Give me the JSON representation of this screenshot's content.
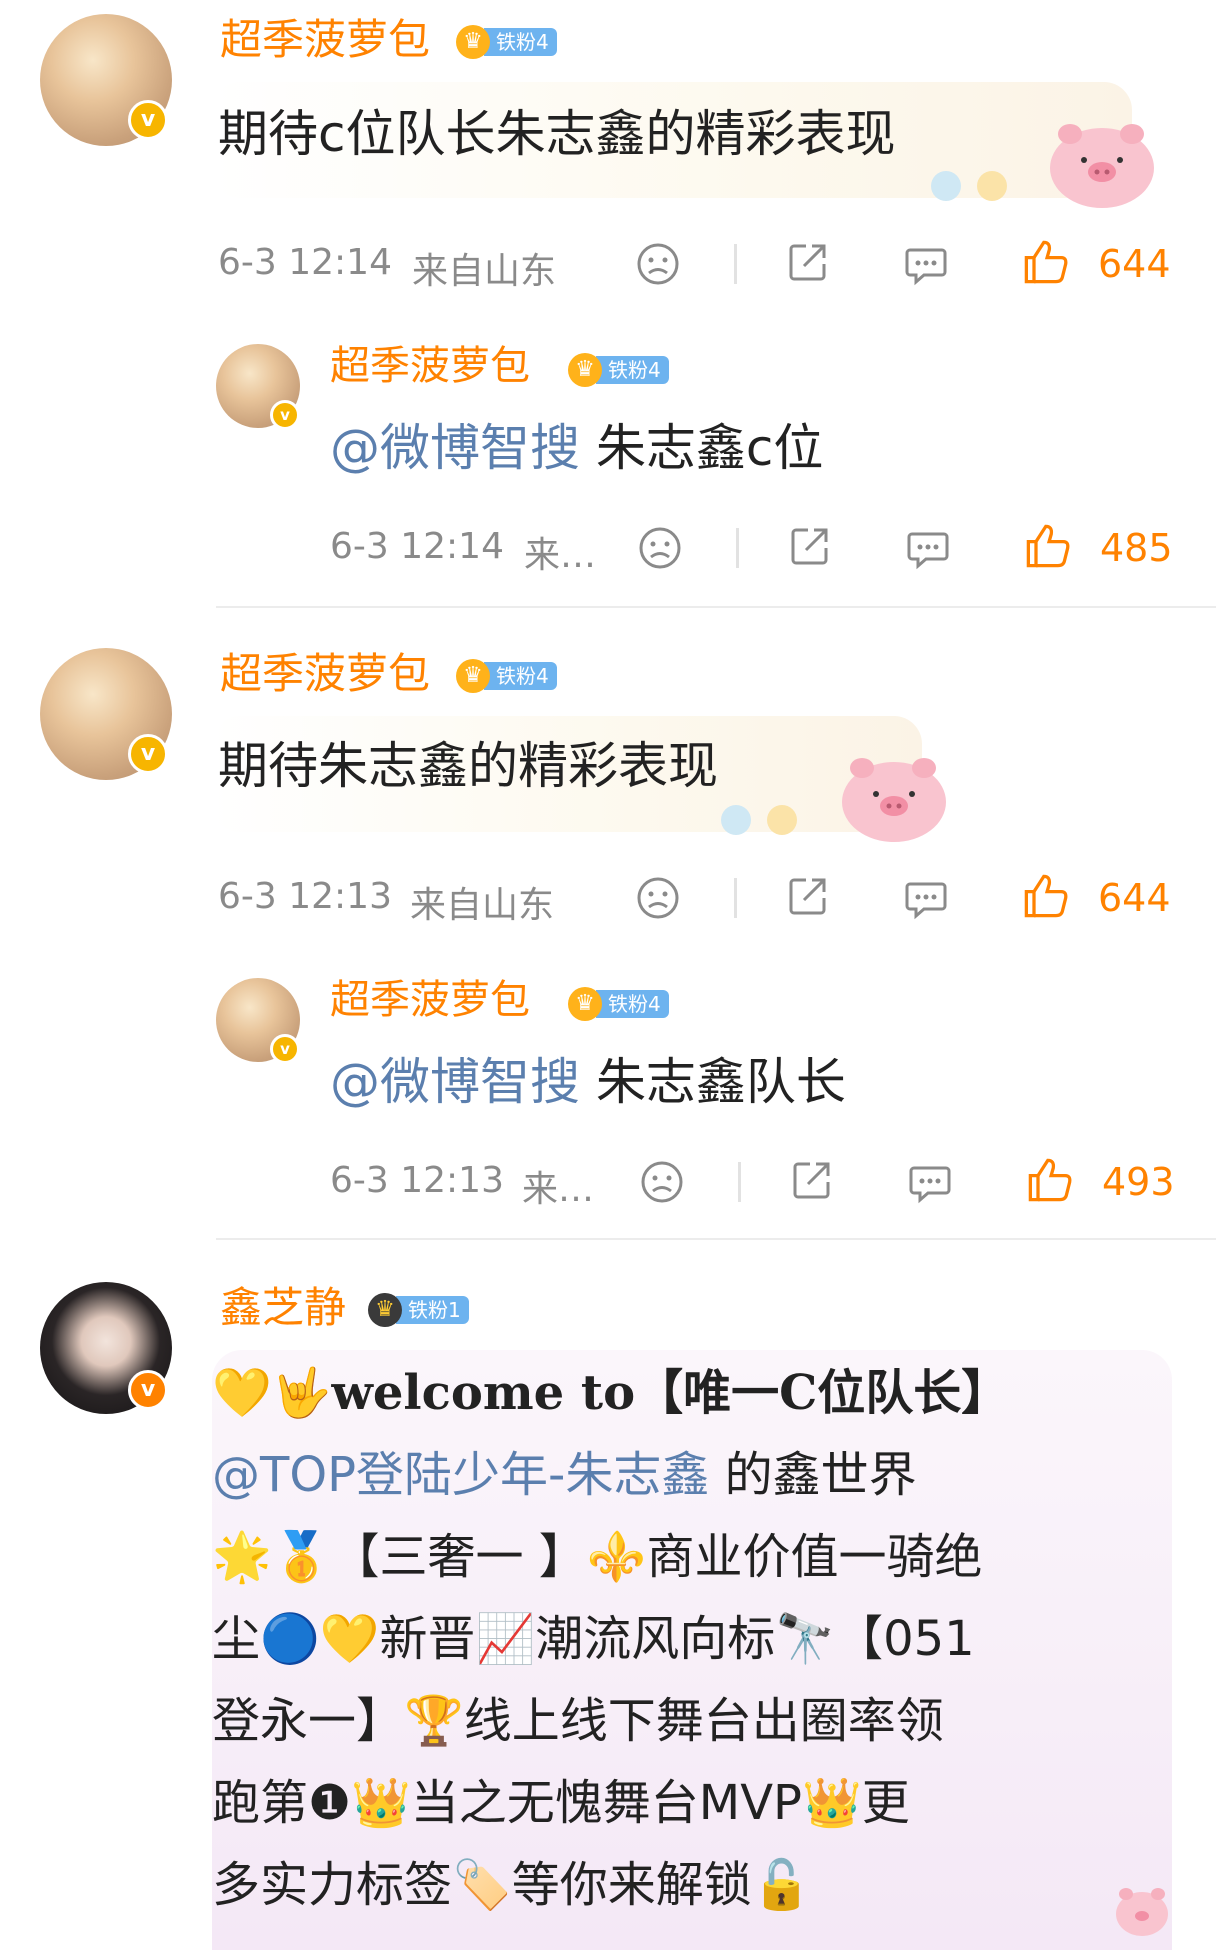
{
  "comments": [
    {
      "user": "超季菠萝包",
      "fan_badge": "铁粉4",
      "text": "期待c位队长朱志鑫的精彩表现",
      "time": "6-3 12:14",
      "source": "来自山东",
      "likes": "644",
      "reply": {
        "user": "超季菠萝包",
        "fan_badge": "铁粉4",
        "mention": "@微博智搜",
        "text": "朱志鑫c位",
        "time": "6-3 12:14",
        "source": "来…",
        "likes": "485"
      }
    },
    {
      "user": "超季菠萝包",
      "fan_badge": "铁粉4",
      "text": "期待朱志鑫的精彩表现",
      "time": "6-3 12:13",
      "source": "来自山东",
      "likes": "644",
      "reply": {
        "user": "超季菠萝包",
        "fan_badge": "铁粉4",
        "mention": "@微博智搜",
        "text": "朱志鑫队长",
        "time": "6-3 12:13",
        "source": "来…",
        "likes": "493"
      }
    },
    {
      "user": "鑫芝静",
      "fan_badge": "铁粉1",
      "line1_emoji": "💛🤟",
      "line1_text": "welcome to【唯一C位队长】",
      "line2_mention": "@TOP登陆少年-朱志鑫",
      "line2_text": " 的鑫世界",
      "line3": "🌟🥇【三奢一 】⚜️商业价值一骑绝",
      "line4": "尘🔵💛新晋📈潮流风向标🔭【051",
      "line5": "登永一】🏆线上线下舞台出圈率领",
      "line6": "跑第❶👑当之无愧舞台MVP👑更",
      "line7": "多实力标签🏷️等你来解锁🔓"
    }
  ],
  "colors": {
    "accent": "#ff8200",
    "mention": "#5b7fae",
    "meta": "#8a8a8a",
    "fan_badge": "#6db3ef"
  },
  "icons": [
    "dislike-face-icon",
    "share-icon",
    "comment-icon",
    "thumbs-up-icon"
  ]
}
